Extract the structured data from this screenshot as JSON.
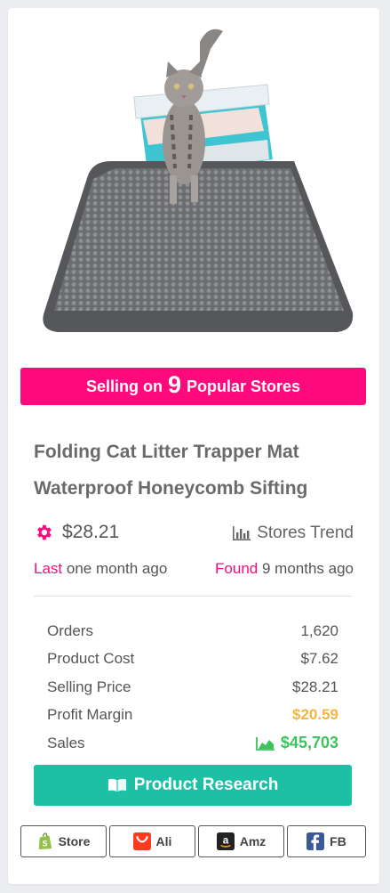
{
  "banner": {
    "prefix": "Selling on",
    "count": "9",
    "suffix": "Popular Stores",
    "color": "#ff0a7c"
  },
  "product": {
    "title_line1": "Folding Cat Litter Trapper Mat",
    "title_line2": "Waterproof Honeycomb Sifting",
    "price": "$28.21",
    "price_icon": "gear-icon"
  },
  "trend": {
    "label": "Stores Trend",
    "icon": "bar-chart-icon"
  },
  "meta": {
    "last_label": "Last",
    "last_value": "one month ago",
    "found_label": "Found",
    "found_value": "9 months ago"
  },
  "stats": [
    {
      "label": "Orders",
      "value": "1,620"
    },
    {
      "label": "Product Cost",
      "value": "$7.62"
    },
    {
      "label": "Selling Price",
      "value": "$28.21"
    },
    {
      "label": "Profit Margin",
      "value": "$20.59"
    },
    {
      "label": "Sales",
      "value": "$45,703"
    }
  ],
  "colors": {
    "accent": "#ff0a7c",
    "teal": "#1ec0a5",
    "profit": "#f5b540",
    "sales": "#3cc35e"
  },
  "research_button": {
    "label": "Product Research",
    "icon": "book-icon"
  },
  "store_links": [
    {
      "label": "Store",
      "icon": "shopify-icon"
    },
    {
      "label": "Ali",
      "icon": "aliexpress-icon"
    },
    {
      "label": "Amz",
      "icon": "amazon-icon"
    },
    {
      "label": "FB",
      "icon": "facebook-icon"
    }
  ]
}
